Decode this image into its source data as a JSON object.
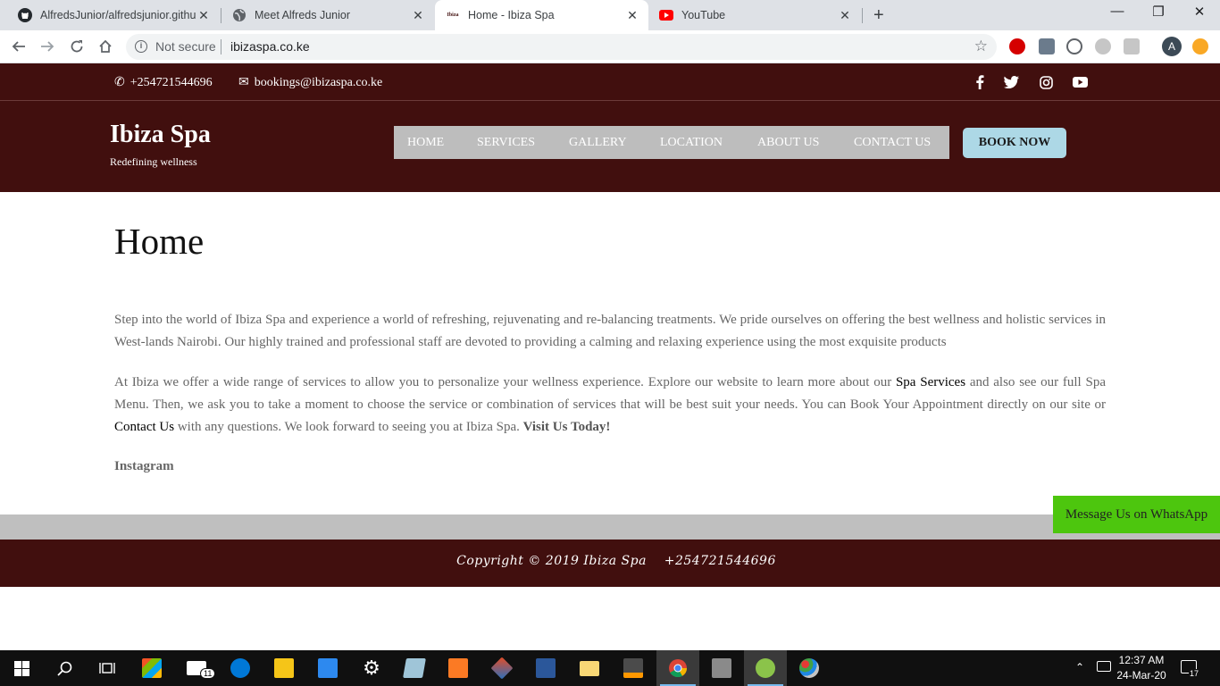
{
  "browser": {
    "tabs": [
      {
        "title": "AlfredsJunior/alfredsjunior.githu",
        "icon": "github-icon"
      },
      {
        "title": "Meet Alfreds Junior",
        "icon": "globe-icon"
      },
      {
        "title": "Home - Ibiza Spa",
        "icon": "ibiza-favicon"
      },
      {
        "title": "YouTube",
        "icon": "youtube-icon"
      }
    ],
    "favicon_ibiza_text": "Ibiza",
    "close_glyph": "✕",
    "new_tab_glyph": "+",
    "security_label": "Not secure",
    "url": "ibizaspa.co.ke",
    "profile_initial": "A",
    "window_controls": {
      "minimize": "—",
      "maximize": "❐",
      "close": "✕"
    }
  },
  "site": {
    "phone": "+254721544696",
    "email": "bookings@ibizaspa.co.ke",
    "brand": "Ibiza Spa",
    "tagline": "Redefining wellness",
    "nav": [
      "HOME",
      "SERVICES",
      "GALLERY",
      "LOCATION",
      "ABOUT US",
      "CONTACT US"
    ],
    "book_now": "BOOK NOW",
    "colors": {
      "brand_maroon": "#410f0e",
      "nav_gray": "#bdbdbd",
      "book_button": "#add8e6",
      "whatsapp_green": "#4dc60e"
    }
  },
  "content": {
    "title": "Home",
    "para1": "Step into the world of Ibiza Spa and experience a world of refreshing, rejuvenating and re-balancing treatments. We pride ourselves on offering the best wellness and holistic services in West-lands Nairobi. Our highly trained and professional staff are devoted to providing a calming and relaxing experience using the most exquisite products",
    "para2_a": "At Ibiza we offer a wide range of services to allow you to personalize your wellness experience. Explore our website to learn more about our ",
    "para2_link1": "Spa Services",
    "para2_b": " and also see our full Spa Menu. Then, we ask you to take a moment to choose the service or combination of services that will be best suit your needs. You can Book Your Appointment directly on our site or ",
    "para2_link2": "Contact Us",
    "para2_c": " with any questions. We look forward to seeing you at Ibiza Spa. ",
    "para2_bold": "Visit Us Today!",
    "instagram": "Instagram"
  },
  "footer": {
    "copyright": "Copyright © 2019 Ibiza Spa    +254721544696",
    "whatsapp": "Message Us on WhatsApp"
  },
  "taskbar": {
    "mail_badge": "11",
    "time": "12:37 AM",
    "date": "24-Mar-20",
    "notification_count": "17"
  }
}
